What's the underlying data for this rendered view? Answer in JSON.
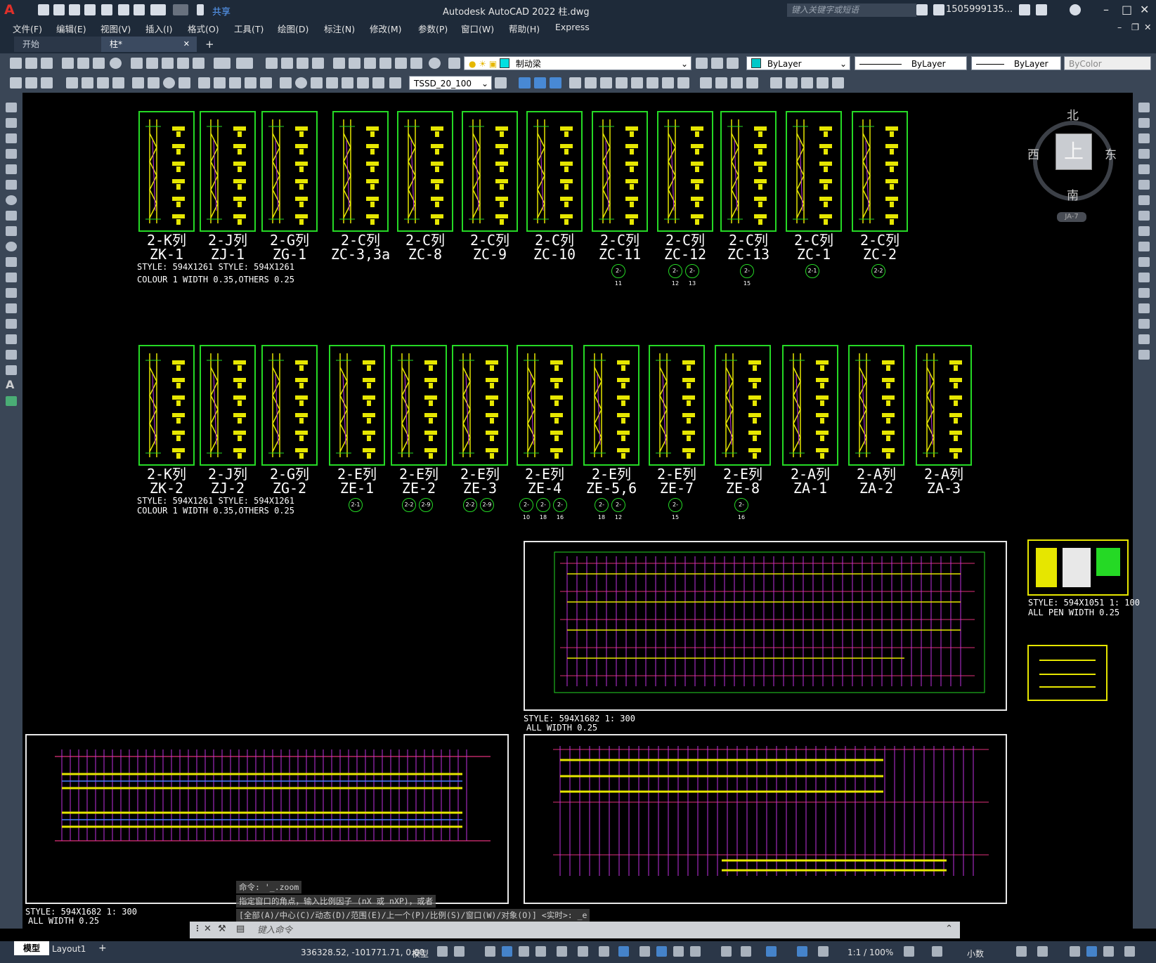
{
  "titlebar": {
    "title": "Autodesk AutoCAD 2022    柱.dwg",
    "share": "共享",
    "search_placeholder": "键入关键字或短语",
    "user": "1505999135...",
    "logo": "A"
  },
  "menus": [
    "文件(F)",
    "编辑(E)",
    "视图(V)",
    "插入(I)",
    "格式(O)",
    "工具(T)",
    "绘图(D)",
    "标注(N)",
    "修改(M)",
    "参数(P)",
    "窗口(W)",
    "帮助(H)",
    "Express"
  ],
  "tabs": {
    "start": "开始",
    "drawing": "柱*",
    "close": "✕",
    "add": "+"
  },
  "toolbar": {
    "layer": "制动梁",
    "color": "ByLayer",
    "linetype": "ByLayer",
    "lineweight": "ByLayer",
    "plotstyle": "ByColor",
    "dimstyle": "TSSD_20_100",
    "layer_color": "#00e0e0",
    "color_swatch": "#00c8c8"
  },
  "viewcube": {
    "face": "上",
    "north": "北",
    "south": "南",
    "east": "东",
    "west": "西",
    "wcs": "JA-7"
  },
  "row1": [
    {
      "top": "2-K列",
      "bottom": "ZK-1",
      "circles": []
    },
    {
      "top": "2-J列",
      "bottom": "ZJ-1",
      "circles": []
    },
    {
      "top": "2-G列",
      "bottom": "ZG-1",
      "circles": []
    },
    {
      "top": "2-C列",
      "bottom": "ZC-3,3a",
      "circles": []
    },
    {
      "top": "2-C列",
      "bottom": "ZC-8",
      "circles": []
    },
    {
      "top": "2-C列",
      "bottom": "ZC-9",
      "circles": []
    },
    {
      "top": "2-C列",
      "bottom": "ZC-10",
      "circles": []
    },
    {
      "top": "2-C列",
      "bottom": "ZC-11",
      "circles": [
        "2-11"
      ]
    },
    {
      "top": "2-C列",
      "bottom": "ZC-12",
      "circles": [
        "2-12",
        "2-13"
      ]
    },
    {
      "top": "2-C列",
      "bottom": "ZC-13",
      "circles": [
        "2-15"
      ]
    },
    {
      "top": "2-C列",
      "bottom": "ZC-1",
      "circles": [
        "2-1"
      ]
    },
    {
      "top": "2-C列",
      "bottom": "ZC-2",
      "circles": [
        "2-2"
      ]
    }
  ],
  "row2": [
    {
      "top": "2-K列",
      "bottom": "ZK-2",
      "circles": []
    },
    {
      "top": "2-J列",
      "bottom": "ZJ-2",
      "circles": []
    },
    {
      "top": "2-G列",
      "bottom": "ZG-2",
      "circles": []
    },
    {
      "top": "2-E列",
      "bottom": "ZE-1",
      "circles": [
        "2-1"
      ]
    },
    {
      "top": "2-E列",
      "bottom": "ZE-2",
      "circles": [
        "2-2",
        "2-9"
      ]
    },
    {
      "top": "2-E列",
      "bottom": "ZE-3",
      "circles": [
        "2-2",
        "2-9"
      ]
    },
    {
      "top": "2-E列",
      "bottom": "ZE-4",
      "circles": [
        "2-10",
        "2-18",
        "2-16"
      ]
    },
    {
      "top": "2-E列",
      "bottom": "ZE-5,6",
      "circles": [
        "2-18",
        "2-12"
      ]
    },
    {
      "top": "2-E列",
      "bottom": "ZE-7",
      "circles": [
        "2-15"
      ]
    },
    {
      "top": "2-E列",
      "bottom": "ZE-8",
      "circles": [
        "2-16"
      ]
    },
    {
      "top": "2-A列",
      "bottom": "ZA-1",
      "circles": []
    },
    {
      "top": "2-A列",
      "bottom": "ZA-2",
      "circles": []
    },
    {
      "top": "2-A列",
      "bottom": "ZA-3",
      "circles": []
    }
  ],
  "style_notes": {
    "row1_a": "STYLE: 594X1261   STYLE: 594X1261",
    "row1_b": "COLOUR 1 WIDTH 0.35,OTHERS 0.25",
    "row2_a": "STYLE: 594X1261   STYLE: 594X1261",
    "row2_b": "COLOUR 1 WIDTH 0.35,OTHERS 0.25",
    "plan1_a": "STYLE: 594X1682 1: 300",
    "plan1_b": "ALL WIDTH 0.25",
    "legend_a": "STYLE: 594X1051 1: 100",
    "legend_b": "ALL PEN WIDTH 0.25",
    "plan2_a": "STYLE: 594X1682 1: 300",
    "plan2_b": "ALL WIDTH 0.25"
  },
  "command": {
    "hist1": "命令: '_.zoom",
    "hist2": "指定窗口的角点，输入比例因子 (nX 或 nXP)，或者",
    "hist3": "[全部(A)/中心(C)/动态(D)/范围(E)/上一个(P)/比例(S)/窗口(W)/对象(O)] <实时>: _e",
    "placeholder": "键入命令"
  },
  "status": {
    "model_tab": "模型",
    "layout_tab": "Layout1",
    "coords": "336328.52, -101771.71, 0.00",
    "space": "模型",
    "scale": "1:1 / 100%",
    "units": "小数"
  }
}
